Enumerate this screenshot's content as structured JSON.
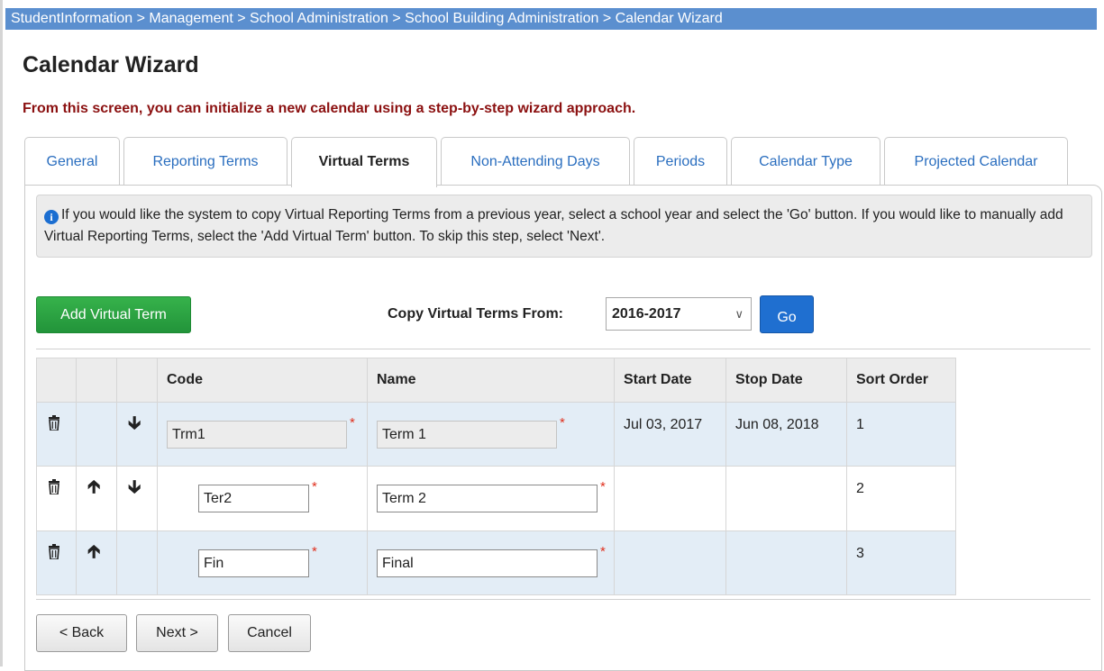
{
  "breadcrumb": "StudentInformation > Management > School Administration > School Building Administration > Calendar Wizard",
  "title": "Calendar Wizard",
  "intro": "From this screen, you can initialize a new calendar using a step-by-step wizard approach.",
  "tabs": [
    {
      "label": "General"
    },
    {
      "label": "Reporting Terms"
    },
    {
      "label": "Virtual Terms",
      "active": true
    },
    {
      "label": "Non-Attending Days"
    },
    {
      "label": "Periods"
    },
    {
      "label": "Calendar Type"
    },
    {
      "label": "Projected Calendar"
    }
  ],
  "info": {
    "icon": "info-icon",
    "text": "If you would like the system to copy Virtual Reporting Terms from a previous year, select a school year and select the 'Go' button. If you would like to manually add Virtual Reporting Terms, select the 'Add Virtual Term' button. To skip this step, select 'Next'."
  },
  "toolbar": {
    "add_label": "Add Virtual Term",
    "copy_label": "Copy Virtual Terms From:",
    "copy_value": "2016-2017",
    "go_label": "Go"
  },
  "table": {
    "headers": [
      "",
      "",
      "",
      "Code",
      "Name",
      "Start Date",
      "Stop Date",
      "Sort Order"
    ],
    "rows": [
      {
        "code": "Trm1",
        "name": "Term 1",
        "start": "Jul 03, 2017",
        "stop": "Jun 08, 2018",
        "sort": "1",
        "readonly": true,
        "up": false,
        "down": true
      },
      {
        "code": "Ter2",
        "name": "Term 2",
        "start": "",
        "stop": "",
        "sort": "2",
        "readonly": false,
        "up": true,
        "down": true
      },
      {
        "code": "Fin",
        "name": "Final",
        "start": "",
        "stop": "",
        "sort": "3",
        "readonly": false,
        "up": true,
        "down": false
      }
    ],
    "required_mark": "*",
    "delete_icon": "trash-icon",
    "up_icon": "arrow-up-icon",
    "down_icon": "arrow-down-icon"
  },
  "footer": {
    "back_label": "< Back",
    "next_label": "Next >",
    "cancel_label": "Cancel"
  },
  "colors": {
    "breadcrumb_bg": "#5b8fcf",
    "intro_text": "#8b1010",
    "tab_link": "#2a6ebf",
    "add_button": "#2ca641",
    "go_button": "#1f6fd0",
    "row_highlight": "#e3edf6",
    "required": "#e0301e"
  }
}
